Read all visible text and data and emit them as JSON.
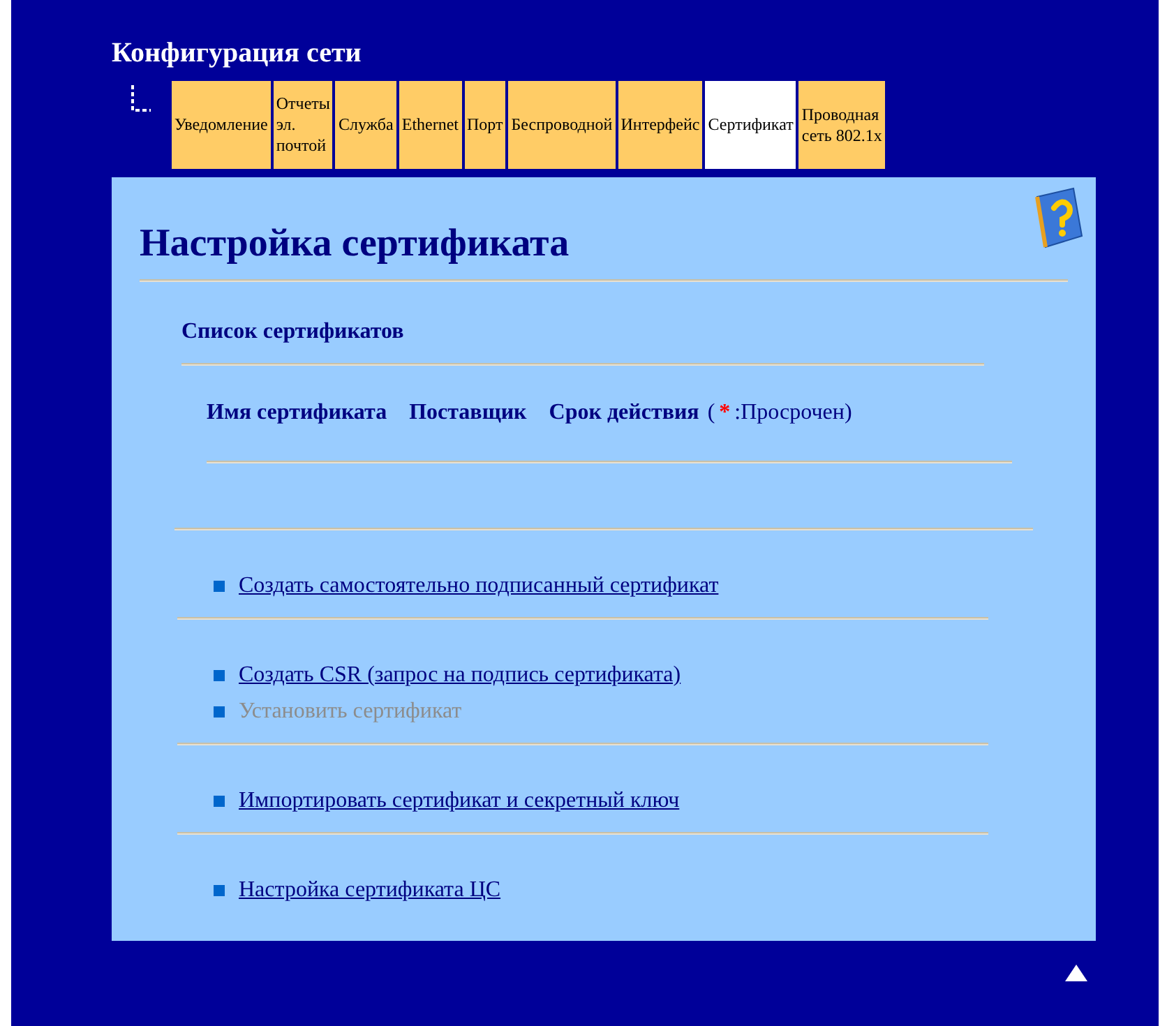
{
  "header": {
    "title": "Конфигурация сети"
  },
  "tabs": [
    {
      "label": "Уведомление",
      "selected": false
    },
    {
      "label": "Отчеты\nэл.\nпочтой",
      "selected": false
    },
    {
      "label": "Служба",
      "selected": false
    },
    {
      "label": "Ethernet",
      "selected": false
    },
    {
      "label": "Порт",
      "selected": false
    },
    {
      "label": "Беспроводной",
      "selected": false
    },
    {
      "label": "Интерфейс",
      "selected": false
    },
    {
      "label": "Сертификат",
      "selected": true
    },
    {
      "label": "Проводная\nсеть 802.1x",
      "selected": false
    }
  ],
  "panel": {
    "title": "Настройка сертификата",
    "list_title": "Список сертификатов",
    "columns": [
      {
        "label": "Имя сертификата"
      },
      {
        "label": "Поставщик"
      },
      {
        "label": "Срок действия"
      }
    ],
    "legend": {
      "open": "(",
      "mark": "*",
      "text": ":Просрочен)"
    },
    "link_groups": [
      [
        {
          "label": "Создать самостоятельно подписанный сертификат",
          "disabled": false
        }
      ],
      [
        {
          "label": "Создать CSR (запрос на подпись сертификата)",
          "disabled": false
        },
        {
          "label": "Установить сертификат",
          "disabled": true
        }
      ],
      [
        {
          "label": "Импортировать сертификат и секретный ключ",
          "disabled": false
        }
      ],
      [
        {
          "label": "Настройка сертификата ЦС",
          "disabled": false
        }
      ]
    ]
  }
}
